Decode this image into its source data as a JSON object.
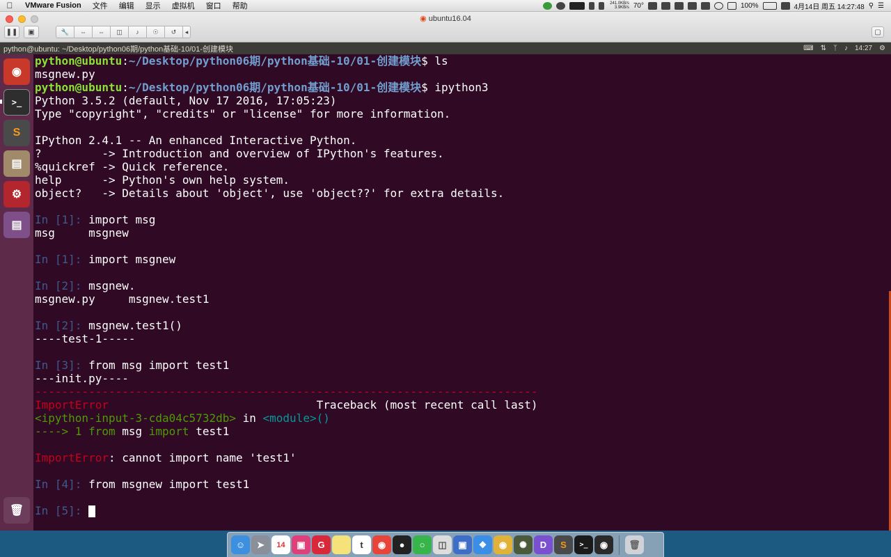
{
  "menubar": {
    "app_name": "VMware Fusion",
    "items": [
      "文件",
      "编辑",
      "显示",
      "虚拟机",
      "窗口",
      "帮助"
    ],
    "net_up": "241.0KB/s",
    "net_down": "3.9KB/s",
    "temperature": "70°",
    "battery": "100%",
    "clock": "4月14日 周五 14:27:48"
  },
  "vmware": {
    "title": "ubuntu16.04"
  },
  "ubuntu_panel": {
    "title": "python@ubuntu: ~/Desktop/python06期/python基础-10/01-创建模块",
    "time": "14:27"
  },
  "terminal": {
    "prompt1": {
      "user": "python@ubuntu",
      "path": "~/Desktop/python06期/python基础-10/01-创建模块",
      "cmd": "$ ls"
    },
    "ls_output": "msgnew.py",
    "prompt2": {
      "user": "python@ubuntu",
      "path": "~/Desktop/python06期/python基础-10/01-创建模块",
      "cmd": "$ ipython3"
    },
    "banner": [
      "Python 3.5.2 (default, Nov 17 2016, 17:05:23)",
      "Type \"copyright\", \"credits\" or \"license\" for more information.",
      "",
      "IPython 2.4.1 -- An enhanced Interactive Python.",
      "?         -> Introduction and overview of IPython's features.",
      "%quickref -> Quick reference.",
      "help      -> Python's own help system.",
      "object?   -> Details about 'object', use 'object??' for extra details."
    ],
    "in1a": {
      "label": "In [",
      "num": "1",
      "end": "]: ",
      "code": "import msg"
    },
    "completion1": "msg     msgnew",
    "in1b": {
      "label": "In [",
      "num": "1",
      "end": "]: ",
      "code": "import msgnew"
    },
    "in2a": {
      "label": "In [",
      "num": "2",
      "end": "]: ",
      "code": "msgnew."
    },
    "completion2": "msgnew.py     msgnew.test1",
    "in2b": {
      "label": "In [",
      "num": "2",
      "end": "]: ",
      "code": "msgnew.test1()"
    },
    "out2": "----test-1-----",
    "in3": {
      "label": "In [",
      "num": "3",
      "end": "]: ",
      "code": "from msg import test1"
    },
    "out3": "---init.py----",
    "tb_dashes": "---------------------------------------------------------------------------",
    "tb_error_name": "ImportError",
    "tb_header": "                               Traceback (most recent call last)",
    "tb_input": "<ipython-input-3-cda04c5732db>",
    "tb_in": " in ",
    "tb_module": "<module>()",
    "tb_arrow": "----> 1 ",
    "tb_from": "from",
    "tb_msg": " msg ",
    "tb_import": "import",
    "tb_test1": " test1",
    "err_name": "ImportError",
    "err_msg": ": cannot import name 'test1'",
    "in4": {
      "label": "In [",
      "num": "4",
      "end": "]: ",
      "code": "from msgnew import test1"
    },
    "in5": {
      "label": "In [",
      "num": "5",
      "end": "]: "
    }
  },
  "launcher_icons": [
    "ubuntu-logo-icon",
    "terminal-icon",
    "sublime-text-icon",
    "file-manager-icon",
    "settings-icon",
    "window-icon",
    "trash-icon"
  ],
  "dock_icons": [
    "finder-icon",
    "launchpad-icon",
    "calendar-icon",
    "screen-icon",
    "app-g-icon",
    "notes-icon",
    "tumblr-icon",
    "weibo-icon",
    "qq-icon",
    "wechat-icon",
    "preview-icon",
    "vmware-icon",
    "safari-icon",
    "chrome-icon",
    "game-icon",
    "dash-icon",
    "sublime-icon",
    "terminal-icon",
    "obs-icon",
    "trash-icon"
  ],
  "colors": {
    "terminal_bg": "#300a24",
    "launcher_bg": "#5e2a4a",
    "prompt_user": "#8ae234",
    "prompt_path": "#729fcf",
    "error_red": "#c4001b"
  }
}
